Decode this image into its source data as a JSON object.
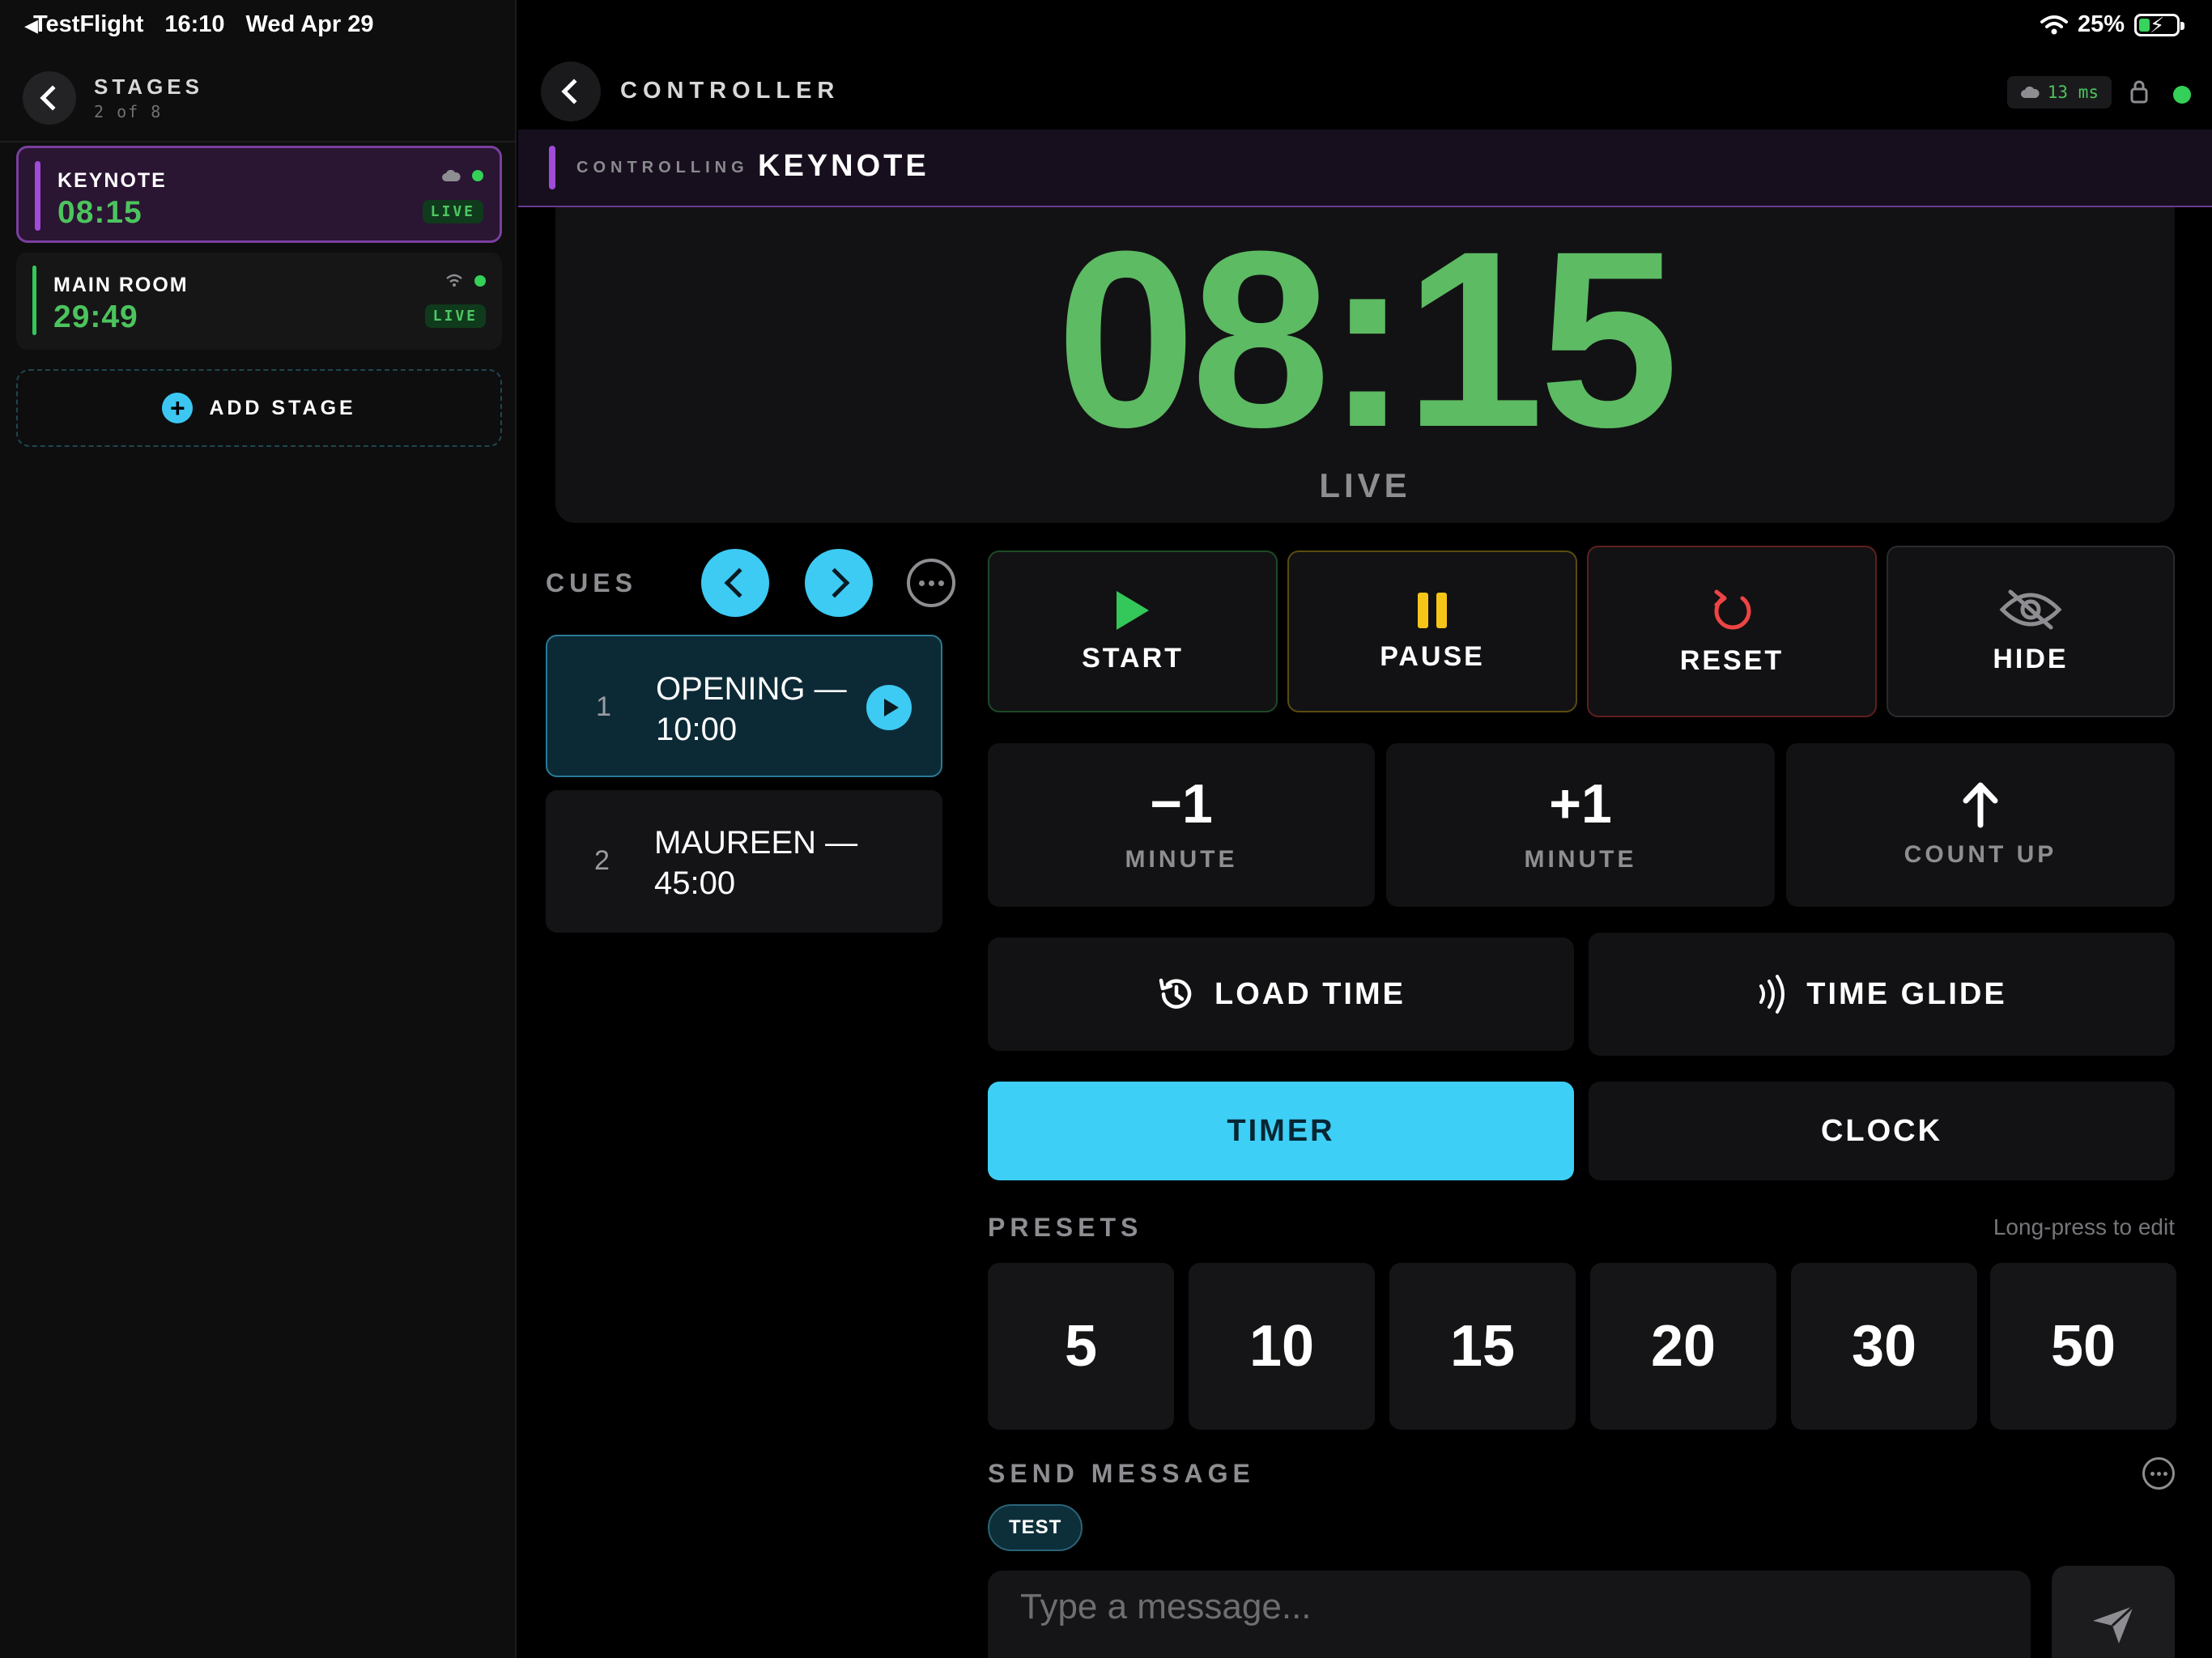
{
  "status_bar": {
    "back_app": "TestFlight",
    "time": "16:10",
    "date": "Wed Apr 29",
    "battery": "25%"
  },
  "sidebar": {
    "title": "STAGES",
    "subtitle": "2 of 8",
    "stages": [
      {
        "name": "KEYNOTE",
        "time": "08:15",
        "badge": "LIVE",
        "connection_icon": "cloud-icon",
        "accent": "#a04cd8"
      },
      {
        "name": "MAIN ROOM",
        "time": "29:49",
        "badge": "LIVE",
        "connection_icon": "wifi-icon",
        "accent": "#34c759"
      }
    ],
    "add_stage_label": "ADD STAGE"
  },
  "header": {
    "title": "CONTROLLER",
    "latency": "13 ms"
  },
  "controlling": {
    "label": "CONTROLLING",
    "stage": "KEYNOTE"
  },
  "display": {
    "time": "08:15",
    "state": "LIVE"
  },
  "cues": {
    "label": "CUES",
    "items": [
      {
        "number": "1",
        "title": "OPENING — 10:00"
      },
      {
        "number": "2",
        "title": "MAUREEN — 45:00"
      }
    ]
  },
  "controls": {
    "start": "START",
    "pause": "PAUSE",
    "reset": "RESET",
    "hide": "HIDE",
    "minus": {
      "value": "−1",
      "unit": "MINUTE"
    },
    "plus": {
      "value": "+1",
      "unit": "MINUTE"
    },
    "count_up": "COUNT UP",
    "load_time": "LOAD TIME",
    "time_glide": "TIME GLIDE",
    "timer": "TIMER",
    "clock": "CLOCK"
  },
  "presets": {
    "label": "PRESETS",
    "hint": "Long-press to edit",
    "values": [
      "5",
      "10",
      "15",
      "20",
      "30",
      "50"
    ]
  },
  "message": {
    "label": "SEND MESSAGE",
    "chips": [
      "TEST"
    ],
    "placeholder": "Type a message..."
  },
  "colors": {
    "accent_cyan": "#3ecff6",
    "time_green": "#5dbb63",
    "start_green": "#34c759",
    "pause_yellow": "#f5c518",
    "reset_red": "#ef4444",
    "keynote_purple": "#a04cd8"
  }
}
